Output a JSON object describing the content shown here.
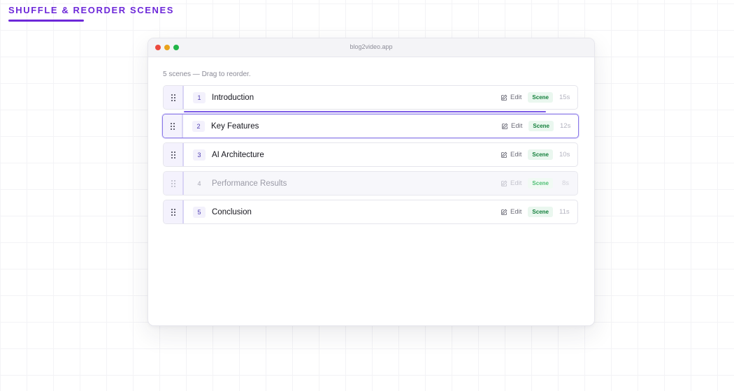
{
  "page": {
    "heading": "SHUFFLE & REORDER SCENES"
  },
  "window": {
    "title": "blog2video.app"
  },
  "hint": "5 scenes — Drag to reorder.",
  "scenes": [
    {
      "number": "1",
      "title": "Introduction",
      "edit_label": "Edit",
      "badge": "Scene",
      "duration": "15s",
      "state": "normal"
    },
    {
      "number": "2",
      "title": "Key Features",
      "edit_label": "Edit",
      "badge": "Scene",
      "duration": "12s",
      "state": "dragover"
    },
    {
      "number": "3",
      "title": "AI Architecture",
      "edit_label": "Edit",
      "badge": "Scene",
      "duration": "10s",
      "state": "normal"
    },
    {
      "number": "4",
      "title": "Performance Results",
      "edit_label": "Edit",
      "badge": "Scene",
      "duration": "8s",
      "state": "dragging"
    },
    {
      "number": "5",
      "title": "Conclusion",
      "edit_label": "Edit",
      "badge": "Scene",
      "duration": "11s",
      "state": "normal"
    }
  ],
  "icons": {
    "drag": "grip-vertical-icon",
    "edit": "pencil-square-icon"
  },
  "colors": {
    "accent": "#6d28d9",
    "drop_indicator": "#7c5ce6",
    "badge_text": "#15803d",
    "badge_bg": "#eaf7ef"
  }
}
